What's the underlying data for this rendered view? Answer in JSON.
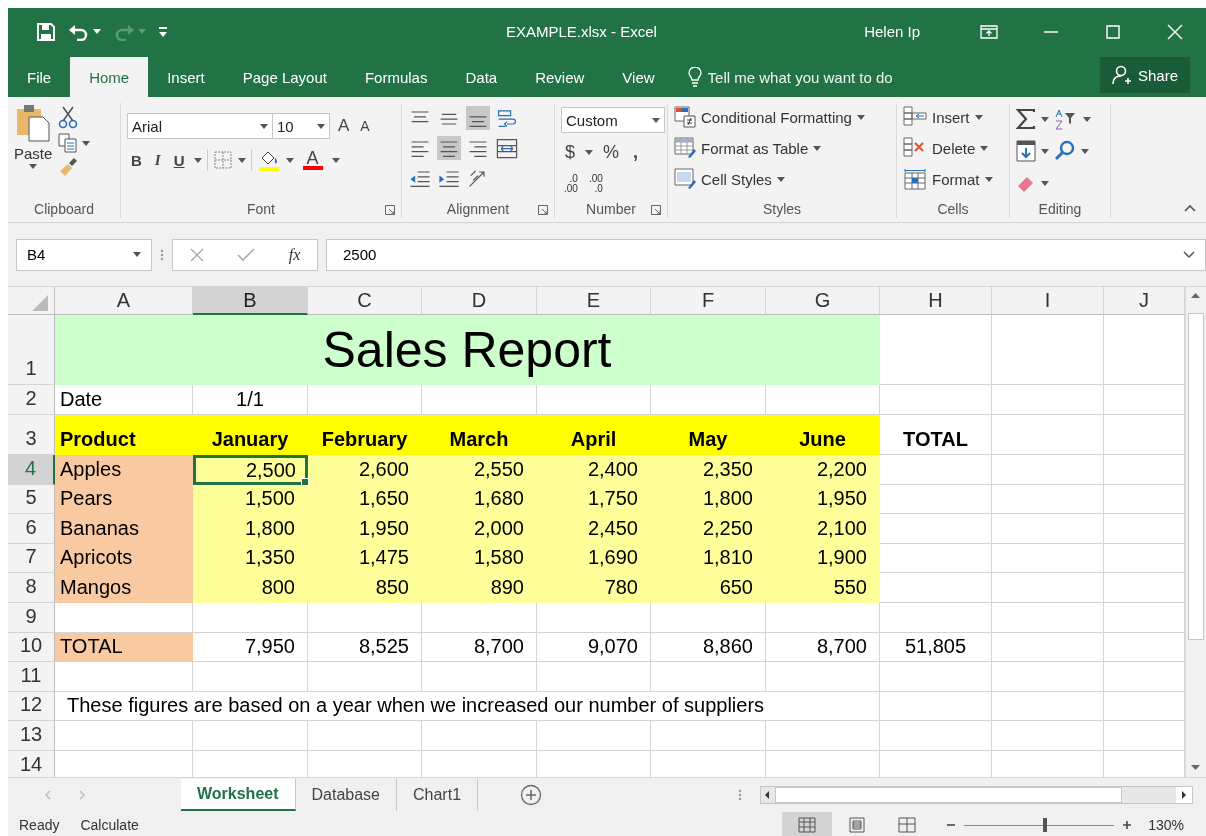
{
  "title_bar": {
    "title": "EXAMPLE.xlsx  -  Excel",
    "user": "Helen Ip",
    "quick_access": [
      {
        "kind": "save",
        "disabled": false
      },
      {
        "kind": "undo",
        "disabled": false
      },
      {
        "kind": "redo",
        "disabled": true
      },
      {
        "kind": "customize",
        "disabled": false
      }
    ]
  },
  "ribbon_tabs": [
    {
      "label": "File",
      "selected": false
    },
    {
      "label": "Home",
      "selected": true
    },
    {
      "label": "Insert",
      "selected": false
    },
    {
      "label": "Page Layout",
      "selected": false
    },
    {
      "label": "Formulas",
      "selected": false
    },
    {
      "label": "Data",
      "selected": false
    },
    {
      "label": "Review",
      "selected": false
    },
    {
      "label": "View",
      "selected": false
    }
  ],
  "tell_me": {
    "placeholder": "Tell me what you want to do"
  },
  "share": "Share",
  "ribbon": {
    "clipboard": {
      "label": "Clipboard",
      "paste": "Paste"
    },
    "font": {
      "label": "Font",
      "font_name": "Arial",
      "font_size": "10",
      "grow": "A",
      "shrink": "A",
      "bold": "B",
      "italic": "I",
      "underline": "U",
      "font_color": "A"
    },
    "alignment": {
      "label": "Alignment",
      "buttons": [
        {
          "kind": "top",
          "selected": false
        },
        {
          "kind": "middle",
          "selected": false
        },
        {
          "kind": "bottom",
          "selected": true
        },
        {
          "kind": "wrap",
          "selected": false
        },
        {
          "kind": "left",
          "selected": false
        },
        {
          "kind": "center",
          "selected": true
        },
        {
          "kind": "right",
          "selected": false
        },
        {
          "kind": "merge",
          "selected": false
        },
        {
          "kind": "outdent",
          "selected": false
        },
        {
          "kind": "indent",
          "selected": false
        },
        {
          "kind": "orientation",
          "selected": false
        }
      ]
    },
    "number": {
      "label": "Number",
      "format": "Custom",
      "currency": "$",
      "percent": "%",
      "comma": ",",
      "increase_decimal": [
        ".0",
        ".00"
      ],
      "decrease_decimal": [
        ".00",
        ".0"
      ]
    },
    "styles": {
      "label": "Styles",
      "buttons": [
        {
          "kind": "conditional",
          "label": "Conditional Formatting"
        },
        {
          "kind": "table",
          "label": "Format as Table"
        },
        {
          "kind": "cellstyles",
          "label": "Cell Styles"
        }
      ]
    },
    "cells": {
      "label": "Cells",
      "buttons": [
        {
          "kind": "insert",
          "label": "Insert"
        },
        {
          "kind": "delete",
          "label": "Delete"
        },
        {
          "kind": "format",
          "label": "Format"
        }
      ]
    },
    "editing": {
      "label": "Editing"
    }
  },
  "formula_bar": {
    "name_box": "B4",
    "fx": "fx",
    "value": "2500"
  },
  "sheet": {
    "columns": [
      {
        "label": "A",
        "selected": false
      },
      {
        "label": "B",
        "selected": true
      },
      {
        "label": "C",
        "selected": false
      },
      {
        "label": "D",
        "selected": false
      },
      {
        "label": "E",
        "selected": false
      },
      {
        "label": "F",
        "selected": false
      },
      {
        "label": "G",
        "selected": false
      },
      {
        "label": "H",
        "selected": false
      },
      {
        "label": "I",
        "selected": false
      },
      {
        "label": "J",
        "selected": false
      }
    ],
    "rows": [
      {
        "label": "1",
        "selected": false,
        "cells": {
          "A": {
            "kind": "title",
            "text": "Sales Report",
            "color": "#ccffcc",
            "selected": false
          }
        }
      },
      {
        "label": "2",
        "selected": false,
        "cells": {
          "A": {
            "kind": "text",
            "text": "Date",
            "selected": false
          },
          "B": {
            "kind": "centered",
            "text": "1/1",
            "selected": false
          }
        }
      },
      {
        "label": "3",
        "selected": false,
        "cells": {
          "A": {
            "kind": "text",
            "text": "Product",
            "bold": true,
            "color": "#ffff00",
            "selected": false
          },
          "B": {
            "kind": "centered",
            "text": "January",
            "bold": true,
            "color": "#ffff00",
            "selected": false
          },
          "C": {
            "kind": "centered",
            "text": "February",
            "bold": true,
            "color": "#ffff00",
            "selected": false
          },
          "D": {
            "kind": "centered",
            "text": "March",
            "bold": true,
            "color": "#ffff00",
            "selected": false
          },
          "E": {
            "kind": "centered",
            "text": "April",
            "bold": true,
            "color": "#ffff00",
            "selected": false
          },
          "F": {
            "kind": "centered",
            "text": "May",
            "bold": true,
            "color": "#ffff00",
            "selected": false
          },
          "G": {
            "kind": "centered",
            "text": "June",
            "bold": true,
            "color": "#ffff00",
            "selected": false
          },
          "H": {
            "kind": "centered",
            "text": "TOTAL",
            "bold": true,
            "selected": false
          }
        }
      },
      {
        "label": "4",
        "selected": true,
        "cells": {
          "A": {
            "kind": "text",
            "text": "Apples",
            "color": "#f9c9a1",
            "selected": false
          },
          "B": {
            "kind": "number",
            "text": "2,500",
            "color": "#ffff99",
            "selected": true
          },
          "C": {
            "kind": "number",
            "text": "2,600",
            "color": "#ffff99",
            "selected": false
          },
          "D": {
            "kind": "number",
            "text": "2,550",
            "color": "#ffff99",
            "selected": false
          },
          "E": {
            "kind": "number",
            "text": "2,400",
            "color": "#ffff99",
            "selected": false
          },
          "F": {
            "kind": "number",
            "text": "2,350",
            "color": "#ffff99",
            "selected": false
          },
          "G": {
            "kind": "number",
            "text": "2,200",
            "color": "#ffff99",
            "selected": false
          }
        }
      },
      {
        "label": "5",
        "selected": false,
        "cells": {
          "A": {
            "kind": "text",
            "text": "Pears",
            "color": "#f9c9a1",
            "selected": false
          },
          "B": {
            "kind": "number",
            "text": "1,500",
            "color": "#ffff99",
            "selected": false
          },
          "C": {
            "kind": "number",
            "text": "1,650",
            "color": "#ffff99",
            "selected": false
          },
          "D": {
            "kind": "number",
            "text": "1,680",
            "color": "#ffff99",
            "selected": false
          },
          "E": {
            "kind": "number",
            "text": "1,750",
            "color": "#ffff99",
            "selected": false
          },
          "F": {
            "kind": "number",
            "text": "1,800",
            "color": "#ffff99",
            "selected": false
          },
          "G": {
            "kind": "number",
            "text": "1,950",
            "color": "#ffff99",
            "selected": false
          }
        }
      },
      {
        "label": "6",
        "selected": false,
        "cells": {
          "A": {
            "kind": "text",
            "text": "Bananas",
            "color": "#f9c9a1",
            "selected": false
          },
          "B": {
            "kind": "number",
            "text": "1,800",
            "color": "#ffff99",
            "selected": false
          },
          "C": {
            "kind": "number",
            "text": "1,950",
            "color": "#ffff99",
            "selected": false
          },
          "D": {
            "kind": "number",
            "text": "2,000",
            "color": "#ffff99",
            "selected": false
          },
          "E": {
            "kind": "number",
            "text": "2,450",
            "color": "#ffff99",
            "selected": false
          },
          "F": {
            "kind": "number",
            "text": "2,250",
            "color": "#ffff99",
            "selected": false
          },
          "G": {
            "kind": "number",
            "text": "2,100",
            "color": "#ffff99",
            "selected": false
          }
        }
      },
      {
        "label": "7",
        "selected": false,
        "cells": {
          "A": {
            "kind": "text",
            "text": "Apricots",
            "color": "#f9c9a1",
            "selected": false
          },
          "B": {
            "kind": "number",
            "text": "1,350",
            "color": "#ffff99",
            "selected": false
          },
          "C": {
            "kind": "number",
            "text": "1,475",
            "color": "#ffff99",
            "selected": false
          },
          "D": {
            "kind": "number",
            "text": "1,580",
            "color": "#ffff99",
            "selected": false
          },
          "E": {
            "kind": "number",
            "text": "1,690",
            "color": "#ffff99",
            "selected": false
          },
          "F": {
            "kind": "number",
            "text": "1,810",
            "color": "#ffff99",
            "selected": false
          },
          "G": {
            "kind": "number",
            "text": "1,900",
            "color": "#ffff99",
            "selected": false
          }
        }
      },
      {
        "label": "8",
        "selected": false,
        "cells": {
          "A": {
            "kind": "text",
            "text": "Mangos",
            "color": "#f9c9a1",
            "selected": false
          },
          "B": {
            "kind": "number",
            "text": "800",
            "color": "#ffff99",
            "selected": false
          },
          "C": {
            "kind": "number",
            "text": "850",
            "color": "#ffff99",
            "selected": false
          },
          "D": {
            "kind": "number",
            "text": "890",
            "color": "#ffff99",
            "selected": false
          },
          "E": {
            "kind": "number",
            "text": "780",
            "color": "#ffff99",
            "selected": false
          },
          "F": {
            "kind": "number",
            "text": "650",
            "color": "#ffff99",
            "selected": false
          },
          "G": {
            "kind": "number",
            "text": "550",
            "color": "#ffff99",
            "selected": false
          }
        }
      },
      {
        "label": "9",
        "selected": false
      },
      {
        "label": "10",
        "selected": false,
        "cells": {
          "A": {
            "kind": "text",
            "text": "TOTAL",
            "color": "#f9c9a1",
            "selected": false
          },
          "B": {
            "kind": "number",
            "text": "7,950",
            "selected": false
          },
          "C": {
            "kind": "number",
            "text": "8,525",
            "selected": false
          },
          "D": {
            "kind": "number",
            "text": "8,700",
            "selected": false
          },
          "E": {
            "kind": "number",
            "text": "9,070",
            "selected": false
          },
          "F": {
            "kind": "number",
            "text": "8,860",
            "selected": false
          },
          "G": {
            "kind": "number",
            "text": "8,700",
            "selected": false
          },
          "H": {
            "kind": "centered",
            "text": "51,805",
            "selected": false
          }
        }
      },
      {
        "label": "11",
        "selected": false
      },
      {
        "label": "12",
        "selected": false,
        "cells": {
          "A": {
            "kind": "note",
            "text": "These figures are based on a year when we increased our number of suppliers",
            "selected": false
          }
        }
      },
      {
        "label": "13",
        "selected": false
      },
      {
        "label": "14",
        "selected": false
      }
    ]
  },
  "sheet_tabs": [
    {
      "label": "Worksheet",
      "selected": true
    },
    {
      "label": "Database",
      "selected": false
    },
    {
      "label": "Chart1",
      "selected": false
    }
  ],
  "status_bar": {
    "items": [
      "Ready",
      "Calculate"
    ],
    "views": [
      {
        "kind": "normal",
        "selected": true
      },
      {
        "kind": "page_layout",
        "selected": false
      },
      {
        "kind": "page_break",
        "selected": false
      }
    ],
    "zoom": {
      "level": 0.54,
      "reading": "130%"
    }
  }
}
